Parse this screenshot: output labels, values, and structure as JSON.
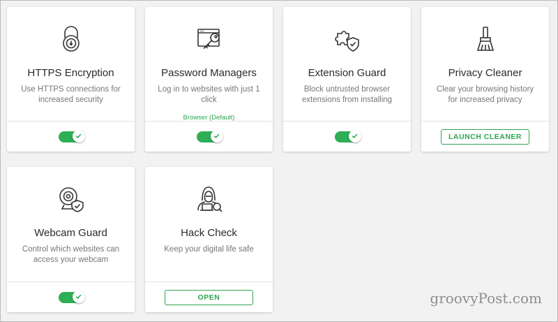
{
  "cards": [
    {
      "title": "HTTPS Encryption",
      "desc": "Use HTTPS connections for increased security",
      "icon": "padlock-icon",
      "footer": "toggle",
      "enabled": true
    },
    {
      "title": "Password Managers",
      "desc": "Log in to websites with just 1 click",
      "sub": "Browser (Default)",
      "icon": "key-window-icon",
      "footer": "toggle",
      "enabled": true
    },
    {
      "title": "Extension Guard",
      "desc": "Block untrusted browser extensions from installing",
      "icon": "puzzle-shield-icon",
      "footer": "toggle",
      "enabled": true
    },
    {
      "title": "Privacy Cleaner",
      "desc": "Clear your browsing history for increased privacy",
      "icon": "broom-icon",
      "footer": "button",
      "button_label": "LAUNCH CLEANER"
    },
    {
      "title": "Webcam Guard",
      "desc": "Control which websites can access your webcam",
      "icon": "webcam-shield-icon",
      "footer": "toggle",
      "enabled": true
    },
    {
      "title": "Hack Check",
      "desc": "Keep your digital life safe",
      "icon": "hacker-icon",
      "footer": "button",
      "button_label": "OPEN"
    }
  ],
  "watermark": "groovyPost.com",
  "colors": {
    "accent": "#2eae55",
    "background": "#f2f2f2",
    "card": "#ffffff",
    "text": "#2b2b2b",
    "muted": "#777777"
  }
}
